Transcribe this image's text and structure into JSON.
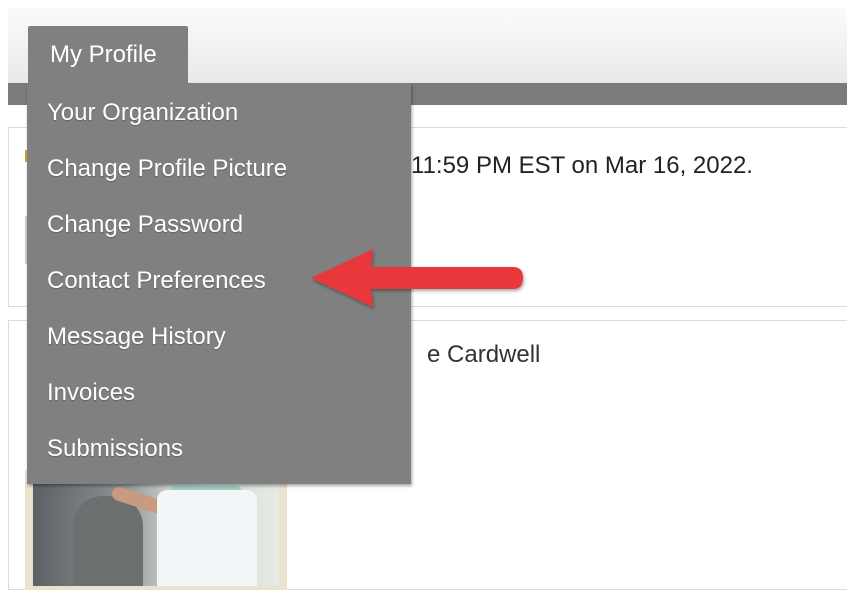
{
  "nav": {
    "active_tab": "My Profile"
  },
  "menu": {
    "items": [
      {
        "label": "Your Organization"
      },
      {
        "label": "Change Profile Picture"
      },
      {
        "label": "Change Password"
      },
      {
        "label": "Contact Preferences"
      },
      {
        "label": "Message History"
      },
      {
        "label": "Invoices"
      },
      {
        "label": "Submissions"
      }
    ]
  },
  "content": {
    "deadline_text": "11:59 PM EST on Mar 16, 2022.",
    "name_fragment": "e Cardwell"
  },
  "annotation": {
    "arrow_color": "#e8373a",
    "arrow_target": "Contact Preferences"
  },
  "colors": {
    "menu_bg": "#808080",
    "menu_text": "#ffffff",
    "nav_strip": "#7b7b7b"
  }
}
